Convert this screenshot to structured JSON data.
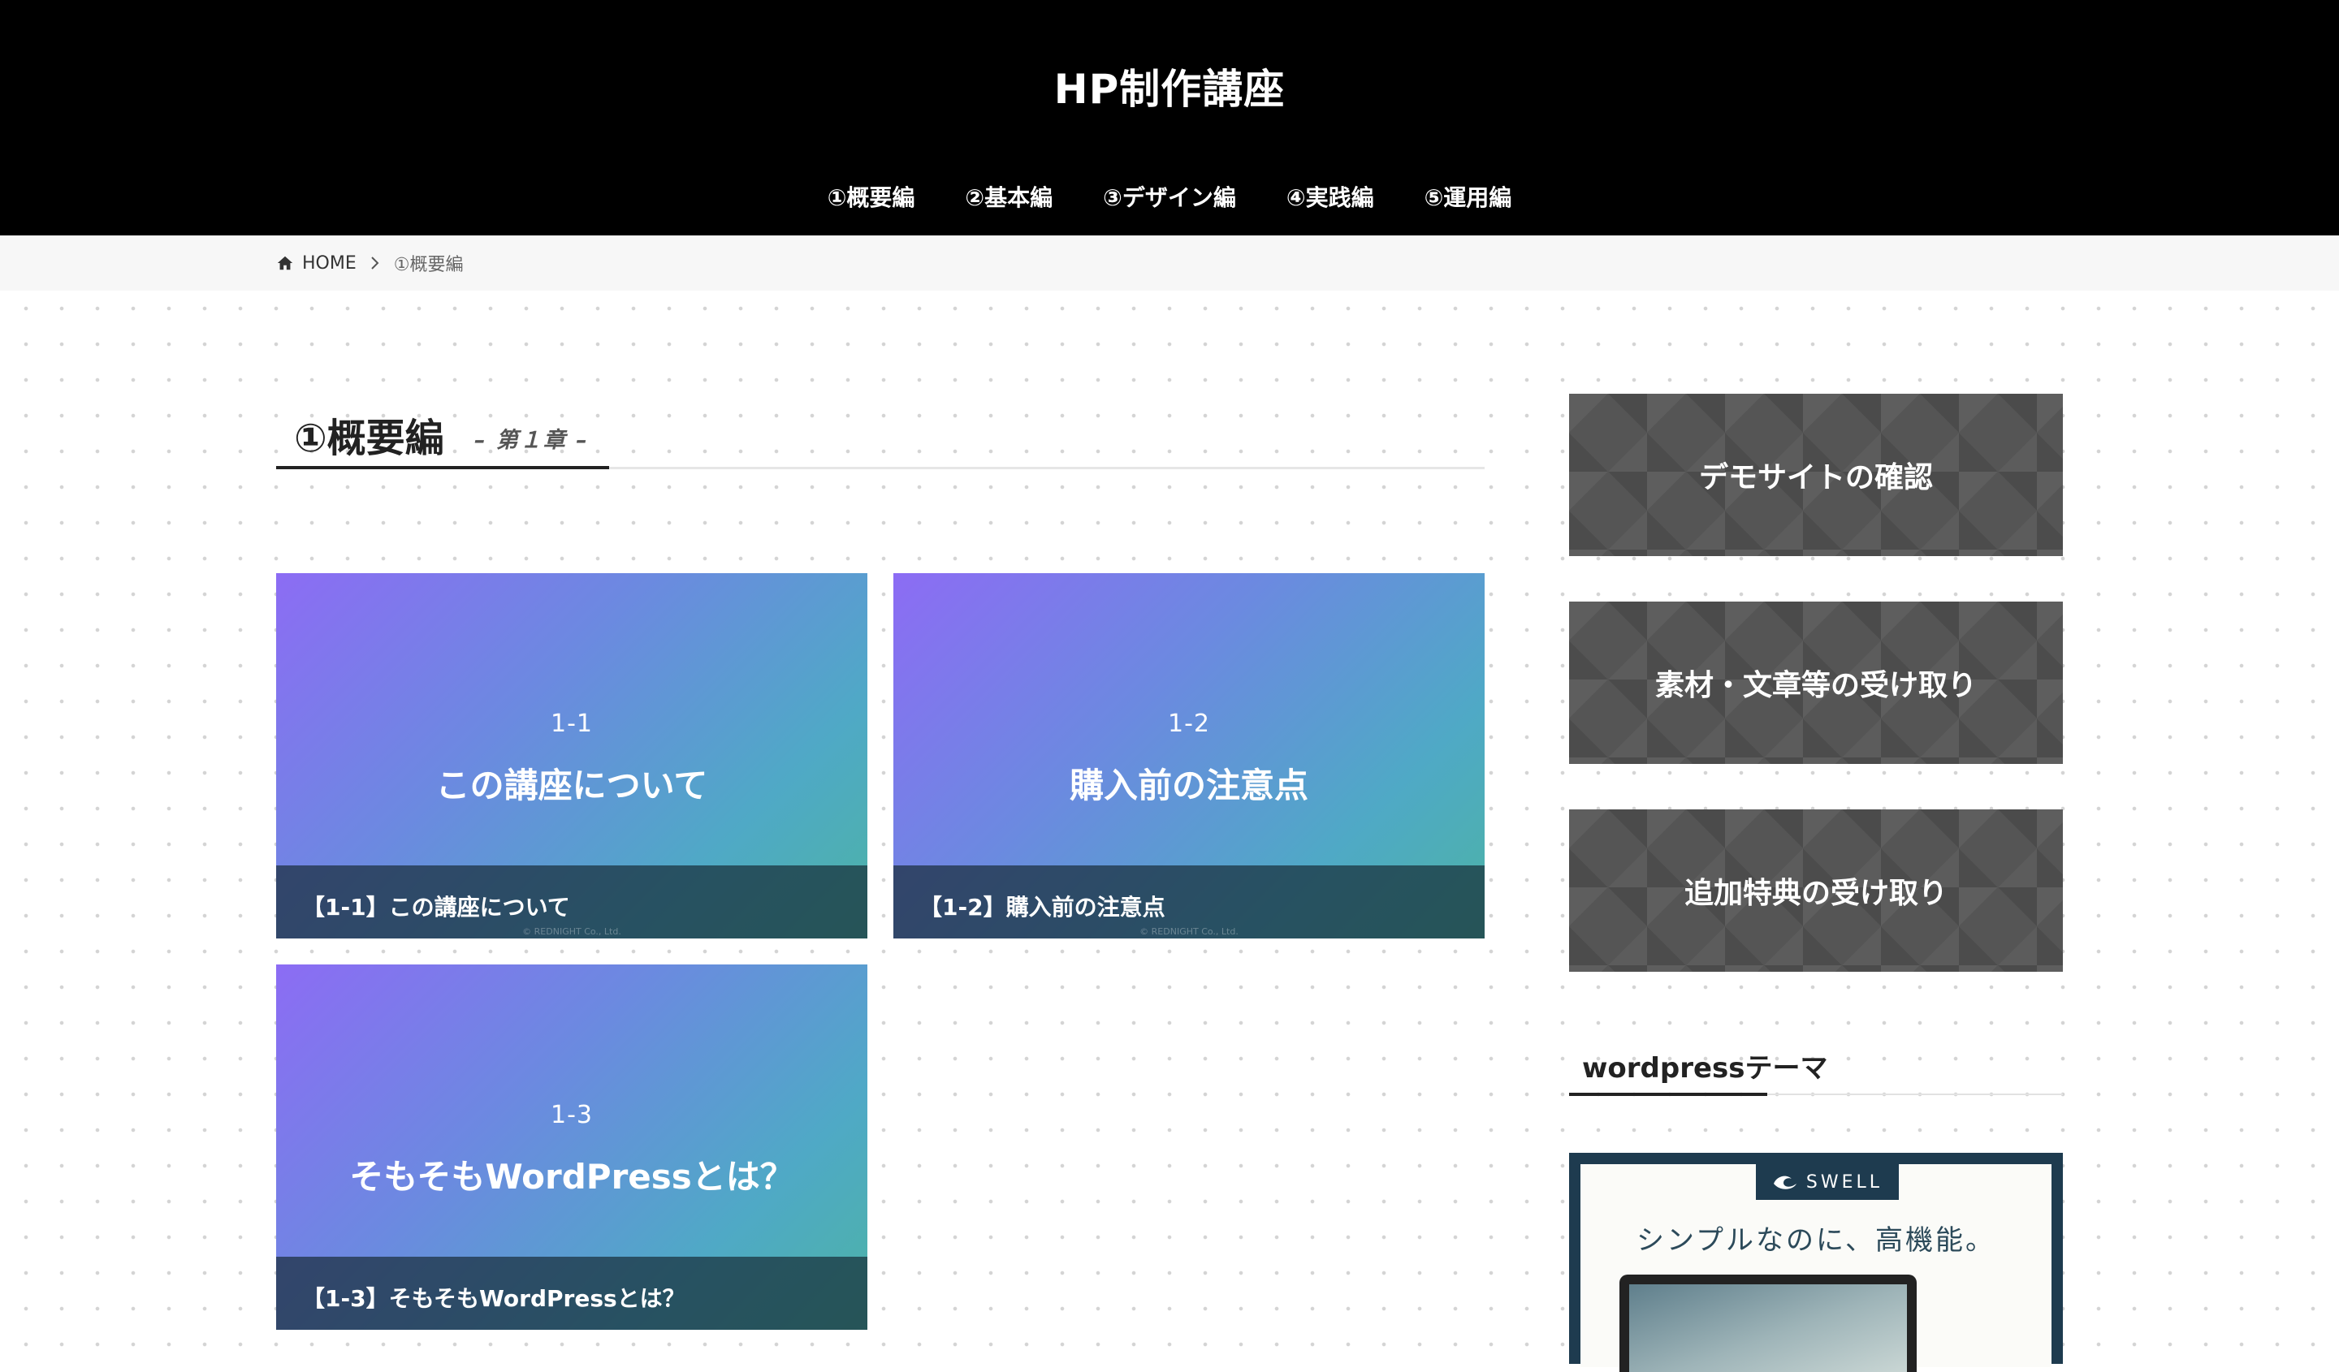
{
  "site": {
    "title": "HP制作講座"
  },
  "nav": {
    "items": [
      {
        "label": "①概要編"
      },
      {
        "label": "②基本編"
      },
      {
        "label": "③デザイン編"
      },
      {
        "label": "④実践編"
      },
      {
        "label": "⑤運用編"
      }
    ]
  },
  "breadcrumb": {
    "home": "HOME",
    "current": "①概要編"
  },
  "page": {
    "title": "①概要編",
    "subtitle": "– 第１章 –"
  },
  "cards": [
    {
      "number": "1-1",
      "headline": "この講座について",
      "caption": "【1-1】この講座について",
      "copyright": "© REDNIGHT Co., Ltd."
    },
    {
      "number": "1-2",
      "headline": "購入前の注意点",
      "caption": "【1-2】購入前の注意点",
      "copyright": "© REDNIGHT Co., Ltd."
    },
    {
      "number": "1-3",
      "headline": "そもそもWordPressとは？",
      "caption": "【1-3】そもそもWordPressとは？",
      "copyright": ""
    }
  ],
  "sidebar": {
    "banners": [
      {
        "label": "デモサイトの確認"
      },
      {
        "label": "素材・文章等の受け取り"
      },
      {
        "label": "追加特典の受け取り"
      }
    ],
    "widget_title": "wordpressテーマ",
    "ad": {
      "logo": "SWELL",
      "tagline": "シンプルなのに、高機能。"
    }
  },
  "colors": {
    "header_bg": "#000000",
    "card_gradient_start": "#8c6cf4",
    "card_gradient_end": "#4cb3a6",
    "banner_bg": "#555555",
    "ad_frame": "#1e3b4f"
  }
}
